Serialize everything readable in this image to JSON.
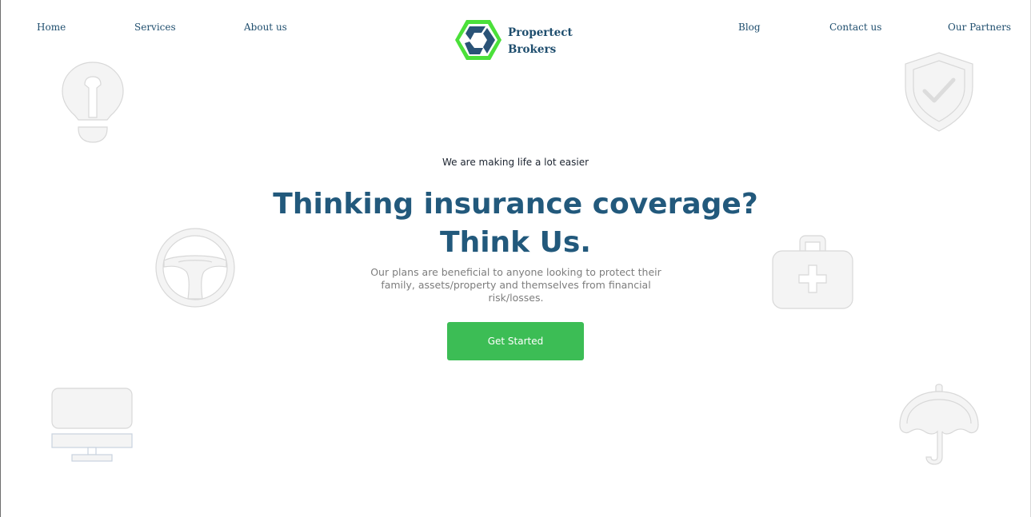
{
  "nav": {
    "left": [
      {
        "label": "Home"
      },
      {
        "label": "Services"
      },
      {
        "label": "About us"
      }
    ],
    "right": [
      {
        "label": "Blog"
      },
      {
        "label": "Contact us"
      },
      {
        "label": "Our Partners"
      }
    ]
  },
  "brand": {
    "name_line1": "Propertect",
    "name_line2": "Brokers",
    "colors": {
      "hex_green": "#4be03a",
      "shape_navy": "#2a5377"
    }
  },
  "hero": {
    "tagline": "We are making life a lot easier",
    "headline_line1": "Thinking insurance coverage?",
    "headline_line2": "Think Us.",
    "description": "Our plans are beneficial to anyone looking to protect their family, assets/property and themselves from financial risk/losses.",
    "cta_label": "Get Started"
  },
  "decorative_icons": [
    "lightbulb-icon",
    "steering-wheel-icon",
    "monitor-icon",
    "shield-check-icon",
    "first-aid-kit-icon",
    "umbrella-icon"
  ],
  "colors": {
    "primary_text": "#22597c",
    "nav_text": "#1f4e6e",
    "cta_background": "#3cbd55",
    "muted_text": "#7d7d7d",
    "icon_fill": "#f4f4f4",
    "icon_stroke": "#d8d8d8"
  }
}
